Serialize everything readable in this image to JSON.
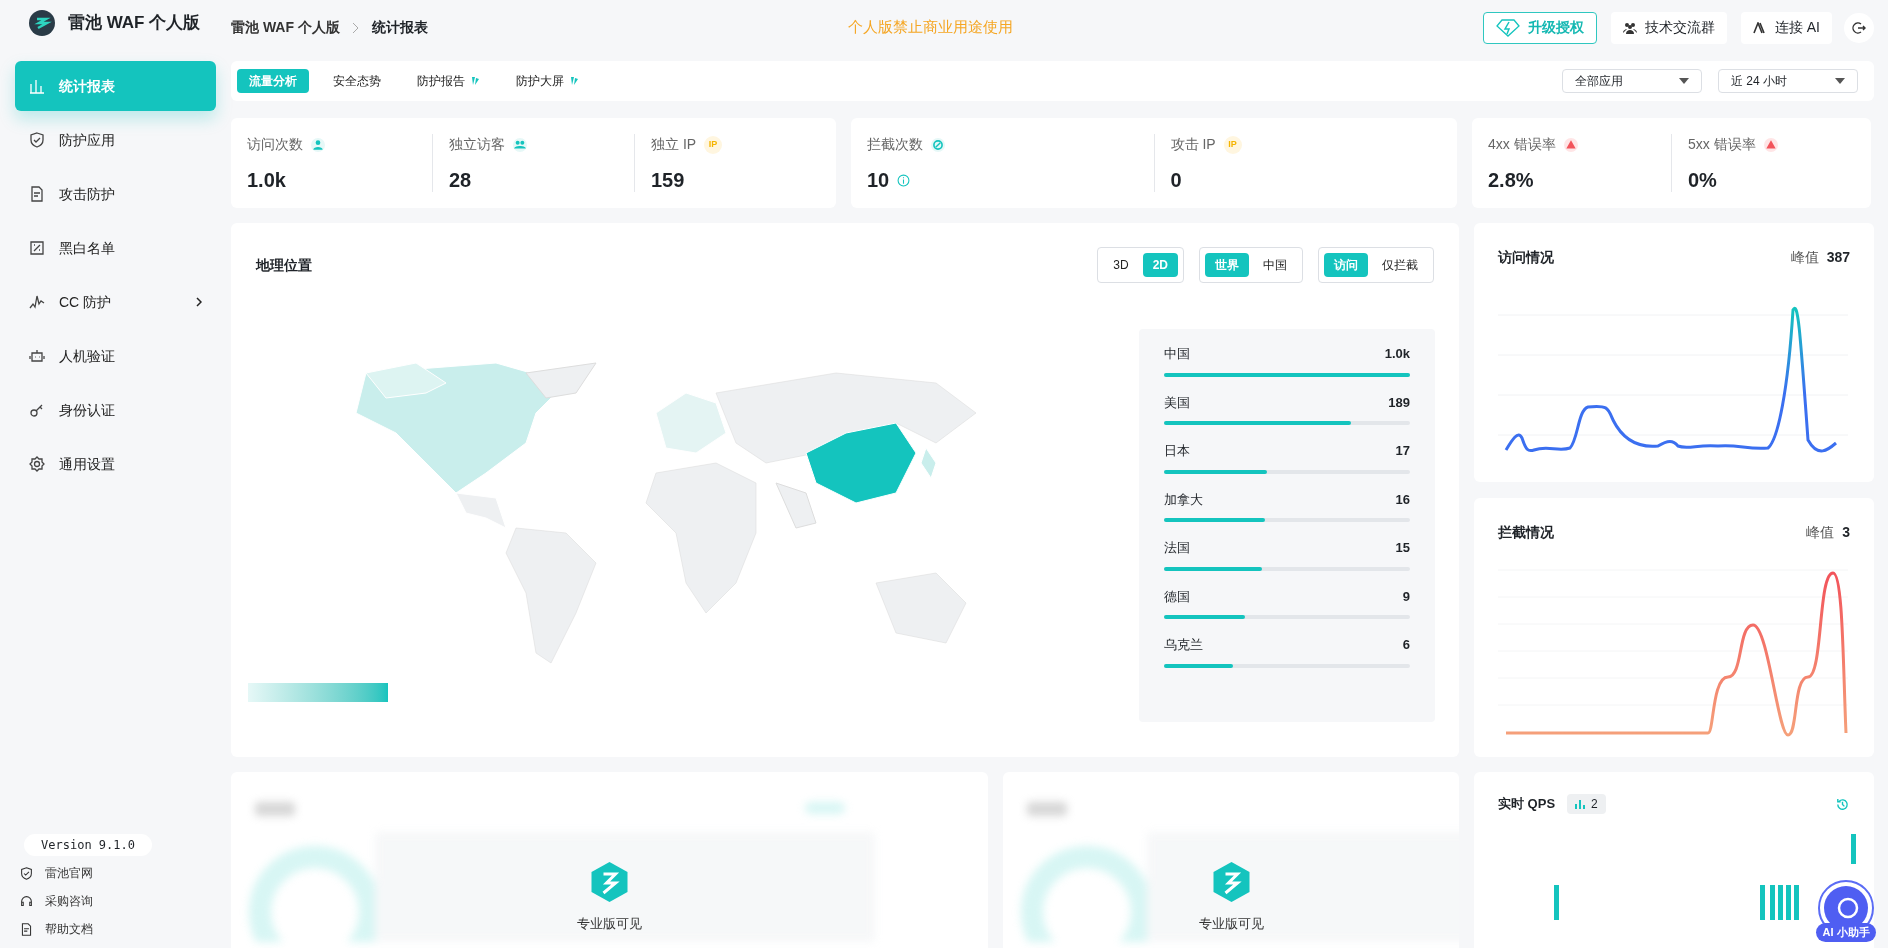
{
  "app": {
    "title": "雷池 WAF 个人版"
  },
  "sidebar": {
    "items": [
      {
        "label": "统计报表",
        "selected": true,
        "submenu": false
      },
      {
        "label": "防护应用",
        "selected": false,
        "submenu": false
      },
      {
        "label": "攻击防护",
        "selected": false,
        "submenu": false
      },
      {
        "label": "黑白名单",
        "selected": false,
        "submenu": false
      },
      {
        "label": "CC 防护",
        "selected": false,
        "submenu": true
      },
      {
        "label": "人机验证",
        "selected": false,
        "submenu": false
      },
      {
        "label": "身份认证",
        "selected": false,
        "submenu": false
      },
      {
        "label": "通用设置",
        "selected": false,
        "submenu": false
      }
    ],
    "version": "Version 9.1.0",
    "links": [
      {
        "label": "雷池官网"
      },
      {
        "label": "采购咨询"
      },
      {
        "label": "帮助文档"
      }
    ]
  },
  "header": {
    "breadcrumb": [
      "雷池 WAF 个人版",
      "统计报表"
    ],
    "notice": "个人版禁止商业用途使用",
    "buttons": [
      {
        "label": "升级授权",
        "kind": "upgrade"
      },
      {
        "label": "技术交流群",
        "kind": "group"
      },
      {
        "label": "连接 AI",
        "kind": "ai"
      }
    ]
  },
  "tabs": [
    {
      "label": "流量分析",
      "selected": true,
      "pro": false
    },
    {
      "label": "安全态势",
      "selected": false,
      "pro": false
    },
    {
      "label": "防护报告",
      "selected": false,
      "pro": true
    },
    {
      "label": "防护大屏",
      "selected": false,
      "pro": true
    }
  ],
  "filters": [
    {
      "value": "全部应用"
    },
    {
      "value": "近 24 小时"
    }
  ],
  "stat_groups": [
    [
      {
        "label": "访问次数",
        "value": "1.0k",
        "info": false
      },
      {
        "label": "独立访客",
        "value": "28",
        "info": false
      },
      {
        "label": "独立 IP",
        "value": "159",
        "tag": "IP",
        "info": false
      }
    ],
    [
      {
        "label": "拦截次数",
        "value": "10",
        "info": true
      },
      {
        "label": "攻击 IP",
        "value": "0",
        "tag": "IP",
        "info": false
      }
    ],
    [
      {
        "label": "4xx 错误率",
        "value": "2.8%",
        "info": false
      },
      {
        "label": "5xx 错误率",
        "value": "0%",
        "info": false
      }
    ]
  ],
  "geo": {
    "title": "地理位置",
    "toggles": [
      [
        {
          "label": "3D",
          "selected": false
        },
        {
          "label": "2D",
          "selected": true
        }
      ],
      [
        {
          "label": "世界",
          "selected": true
        },
        {
          "label": "中国",
          "selected": false
        }
      ],
      [
        {
          "label": "访问",
          "selected": true
        },
        {
          "label": "仅拦截",
          "selected": false
        }
      ]
    ],
    "countries": [
      {
        "name": "中国",
        "value": "1.0k",
        "level": 1.0
      },
      {
        "name": "美国",
        "value": "189",
        "level": 0.76
      },
      {
        "name": "日本",
        "value": "17",
        "level": 0.42
      },
      {
        "name": "加拿大",
        "value": "16",
        "level": 0.41
      },
      {
        "name": "法国",
        "value": "15",
        "level": 0.4
      },
      {
        "name": "德国",
        "value": "9",
        "level": 0.33
      },
      {
        "name": "乌克兰",
        "value": "6",
        "level": 0.28
      }
    ]
  },
  "visits": {
    "title": "访问情况",
    "peak_label": "峰值",
    "peak": "387"
  },
  "blocks": {
    "title": "拦截情况",
    "peak_label": "峰值",
    "peak": "3"
  },
  "pro_panels": [
    {
      "label": "专业版可见"
    },
    {
      "label": "专业版可见"
    }
  ],
  "qps": {
    "title": "实时 QPS",
    "count": "2"
  },
  "assistant": {
    "label": "AI 小助手"
  }
}
